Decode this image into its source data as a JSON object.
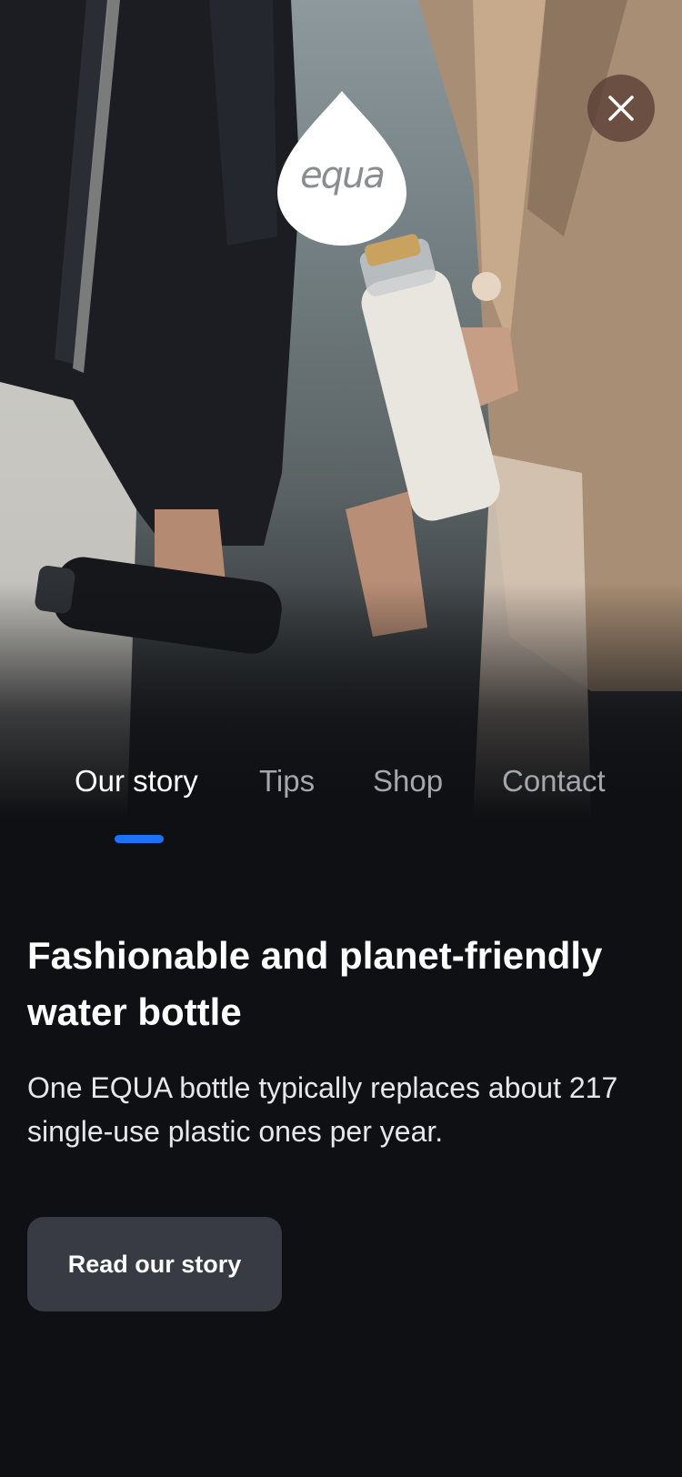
{
  "hero": {
    "image_description_icon": "hero-photo",
    "logo_text": "equa"
  },
  "close": {
    "icon": "close-icon"
  },
  "tabs": [
    {
      "label": "Our story",
      "active": true
    },
    {
      "label": "Tips",
      "active": false
    },
    {
      "label": "Shop",
      "active": false
    },
    {
      "label": "Contact",
      "active": false
    }
  ],
  "content": {
    "headline": "Fashionable and planet-friendly water bottle",
    "body": "One EQUA bottle typically replaces about 217 single-use plastic ones per year.",
    "cta_label": "Read our story"
  },
  "colors": {
    "background": "#0f1013",
    "tab_indicator": "#1a73f0",
    "cta_background": "#383b43",
    "close_background": "#583e34"
  }
}
